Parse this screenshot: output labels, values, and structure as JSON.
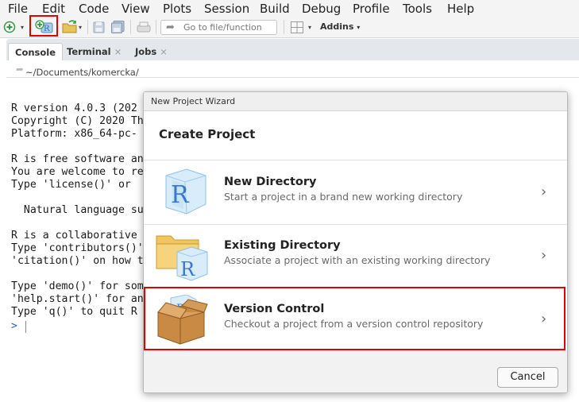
{
  "menubar": {
    "items": [
      "File",
      "Edit",
      "Code",
      "View",
      "Plots",
      "Session",
      "Build",
      "Debug",
      "Profile",
      "Tools",
      "Help"
    ]
  },
  "toolbar": {
    "goto_placeholder": "Go to file/function",
    "addins_label": "Addins"
  },
  "tabs": [
    {
      "label": "Console",
      "active": true
    },
    {
      "label": "Terminal",
      "close": "×"
    },
    {
      "label": "Jobs",
      "close": "×"
    }
  ],
  "path": "~/Documents/komercka/",
  "console": {
    "lines": [
      "R version 4.0.3 (202",
      "Copyright (C) 2020 Th",
      "Platform: x86_64-pc-",
      "",
      "R is free software an",
      "You are welcome to re",
      "Type 'license()' or ",
      "",
      "  Natural language su",
      "",
      "R is a collaborative ",
      "Type 'contributors()'",
      "'citation()' on how t",
      "",
      "Type 'demo()' for som",
      "'help.start()' for an",
      "Type 'q()' to quit R"
    ],
    "prompt": ">"
  },
  "dialog": {
    "window_title": "New Project Wizard",
    "heading": "Create Project",
    "options": [
      {
        "title": "New Directory",
        "description": "Start a project in a brand new working directory",
        "chevron": "›"
      },
      {
        "title": "Existing Directory",
        "description": "Associate a project with an existing working directory",
        "chevron": "›"
      },
      {
        "title": "Version Control",
        "description": "Checkout a project from a version control repository",
        "chevron": "›"
      }
    ],
    "cancel_label": "Cancel"
  },
  "colors": {
    "highlight": "#e00000",
    "prompt": "#3060b0",
    "r_blue": "#3a78c9"
  }
}
